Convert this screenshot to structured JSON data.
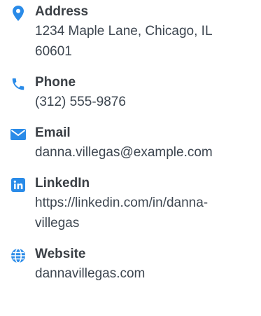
{
  "accent_color": "#2a8be8",
  "contacts": [
    {
      "icon": "location-pin-icon",
      "label": "Address",
      "value_lines": [
        "1234 Maple Lane, Chicago, IL",
        "60601"
      ]
    },
    {
      "icon": "phone-icon",
      "label": "Phone",
      "value_lines": [
        "(312) 555-9876"
      ]
    },
    {
      "icon": "envelope-icon",
      "label": "Email",
      "value_lines": [
        "danna.villegas@example.com"
      ]
    },
    {
      "icon": "linkedin-icon",
      "label": "LinkedIn",
      "value_lines": [
        "https://linkedin.com/in/danna-",
        "villegas"
      ]
    },
    {
      "icon": "globe-icon",
      "label": "Website",
      "value_lines": [
        "dannavillegas.com"
      ]
    }
  ]
}
